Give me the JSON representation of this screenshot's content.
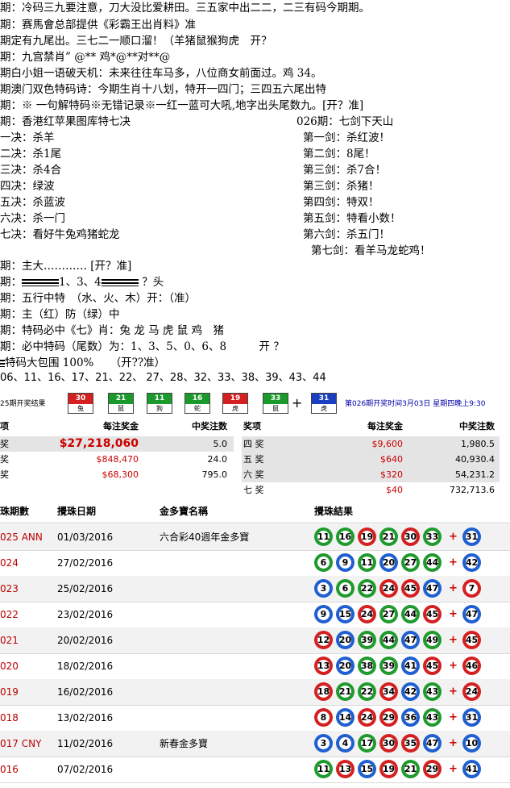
{
  "text_lines": [
    "期：冷码三九要注意，刀大没比爱耕田。三五家中出二二，二三有码今期期。",
    "期：赛馬會总部提供《彩霸王出肖料》准",
    "期定有九尾出。三七二一顺口溜！（羊猪鼠猴狗虎　开？",
    "期：九宫禁肖” @** 鸡*@**对**@",
    "期白小姐一语破天机：未来往往车马多，八位商女前面过。鸡 34。",
    "期澳门双色特码诗：今期生肖十八划，特开一四门；三四五六尾出特",
    "期：※ 一句解特码※无错记录※一红一蓝可大吼,地字出头尾数九。[开？准]"
  ],
  "left_title": "期：香港红苹果图库特七决",
  "left_items": [
    "一决：杀羊",
    "二决：杀1尾",
    "三决：杀4合",
    "四决：绿波",
    "五决：杀蓝波",
    "六决：杀一门",
    "七决：看好牛兔鸡猪蛇龙"
  ],
  "right_title": "026期：七剑下天山",
  "right_items": [
    "第一剑：杀红波！",
    "第二剑：8尾！",
    "第三剑：杀7合！",
    "第三剑：杀猪！",
    "第四剑：特双！",
    "第五剑：特看小数！",
    "第六剑：杀五门！",
    "第七剑：看羊马龙蛇鸡！"
  ],
  "lower_lines": [
    "期：主大………… [开？准]",
    "期：",
    "期：五行中特　（水、火、木）开：（准）",
    "期：主（红）防（绿）中",
    "期：特码必中《七》肖：兔 龙 马 虎 鼠 鸡　猪",
    "期：必中特码（尾数）为：1、3、5、0、6、8　　　开 ？",
    "特码大包围 100%　　（开??准）"
  ],
  "bar_line": {
    "middle": "1、3、4",
    "end": "？头"
  },
  "numbers_line": "06、11、16、17、21、22、 27、28、32、33、38、39、43、44",
  "draw": {
    "label": "25期开奖结果",
    "balls": [
      {
        "num": "30",
        "zodiac": "兔",
        "color": "#d42020"
      },
      {
        "num": "21",
        "zodiac": "鼠",
        "color": "#1a9a2a"
      },
      {
        "num": "11",
        "zodiac": "狗",
        "color": "#1a9a2a"
      },
      {
        "num": "16",
        "zodiac": "蛇",
        "color": "#1a9a2a"
      },
      {
        "num": "19",
        "zodiac": "虎",
        "color": "#d42020"
      },
      {
        "num": "33",
        "zodiac": "鼠",
        "color": "#1a9a2a"
      }
    ],
    "special": {
      "num": "31",
      "zodiac": "虎",
      "color": "#1a3fc0"
    },
    "next_period": "第026期开奖时间3月03日 星期四晚上9:30"
  },
  "prize_left": {
    "headers": [
      "项",
      "每注奖金",
      "中奖注数"
    ],
    "rows": [
      {
        "name": "奖",
        "amount": "$27,218,060",
        "count": "5.0"
      },
      {
        "name": "奖",
        "amount": "$848,470",
        "count": "24.0"
      },
      {
        "name": "奖",
        "amount": "$68,300",
        "count": "795.0"
      }
    ]
  },
  "prize_right": {
    "headers": [
      "奖项",
      "每注奖金",
      "中奖注数"
    ],
    "rows": [
      {
        "name": "四 奖",
        "amount": "$9,600",
        "count": "1,980.5"
      },
      {
        "name": "五 奖",
        "amount": "$640",
        "count": "40,930.4"
      },
      {
        "name": "六 奖",
        "amount": "$320",
        "count": "54,231.2"
      },
      {
        "name": "七 奖",
        "amount": "$40",
        "count": "732,713.6"
      }
    ]
  },
  "history": {
    "headers": [
      "珠期數",
      "攪珠日期",
      "金多寶名稱",
      "攪珠結果"
    ],
    "rows": [
      {
        "id": "025 ANN",
        "date": "01/03/2016",
        "name": "六合彩40週年金多寶",
        "balls": [
          [
            "11",
            "g"
          ],
          [
            "16",
            "g"
          ],
          [
            "19",
            "r"
          ],
          [
            "21",
            "g"
          ],
          [
            "30",
            "r"
          ],
          [
            "33",
            "g"
          ]
        ],
        "special": [
          "31",
          "b"
        ]
      },
      {
        "id": "024",
        "date": "27/02/2016",
        "name": "",
        "balls": [
          [
            "6",
            "g"
          ],
          [
            "9",
            "b"
          ],
          [
            "11",
            "g"
          ],
          [
            "20",
            "b"
          ],
          [
            "27",
            "g"
          ],
          [
            "44",
            "g"
          ]
        ],
        "special": [
          "42",
          "b"
        ]
      },
      {
        "id": "023",
        "date": "25/02/2016",
        "name": "",
        "balls": [
          [
            "3",
            "b"
          ],
          [
            "6",
            "g"
          ],
          [
            "22",
            "g"
          ],
          [
            "24",
            "r"
          ],
          [
            "45",
            "r"
          ],
          [
            "47",
            "b"
          ]
        ],
        "special": [
          "7",
          "r"
        ]
      },
      {
        "id": "022",
        "date": "23/02/2016",
        "name": "",
        "balls": [
          [
            "9",
            "b"
          ],
          [
            "15",
            "b"
          ],
          [
            "24",
            "r"
          ],
          [
            "27",
            "g"
          ],
          [
            "44",
            "g"
          ],
          [
            "45",
            "r"
          ]
        ],
        "special": [
          "47",
          "b"
        ]
      },
      {
        "id": "021",
        "date": "20/02/2016",
        "name": "",
        "balls": [
          [
            "12",
            "r"
          ],
          [
            "20",
            "b"
          ],
          [
            "39",
            "g"
          ],
          [
            "44",
            "g"
          ],
          [
            "47",
            "b"
          ],
          [
            "49",
            "g"
          ]
        ],
        "special": [
          "45",
          "r"
        ]
      },
      {
        "id": "020",
        "date": "18/02/2016",
        "name": "",
        "balls": [
          [
            "13",
            "r"
          ],
          [
            "20",
            "b"
          ],
          [
            "38",
            "g"
          ],
          [
            "39",
            "g"
          ],
          [
            "41",
            "b"
          ],
          [
            "45",
            "r"
          ]
        ],
        "special": [
          "46",
          "r"
        ]
      },
      {
        "id": "019",
        "date": "16/02/2016",
        "name": "",
        "balls": [
          [
            "18",
            "r"
          ],
          [
            "21",
            "g"
          ],
          [
            "22",
            "g"
          ],
          [
            "34",
            "r"
          ],
          [
            "42",
            "b"
          ],
          [
            "43",
            "g"
          ]
        ],
        "special": [
          "24",
          "r"
        ]
      },
      {
        "id": "018",
        "date": "13/02/2016",
        "name": "",
        "balls": [
          [
            "8",
            "r"
          ],
          [
            "14",
            "b"
          ],
          [
            "24",
            "r"
          ],
          [
            "29",
            "r"
          ],
          [
            "36",
            "b"
          ],
          [
            "43",
            "g"
          ]
        ],
        "special": [
          "31",
          "b"
        ]
      },
      {
        "id": "017 CNY",
        "date": "11/02/2016",
        "name": "新春金多寶",
        "balls": [
          [
            "3",
            "b"
          ],
          [
            "4",
            "b"
          ],
          [
            "17",
            "g"
          ],
          [
            "30",
            "r"
          ],
          [
            "35",
            "r"
          ],
          [
            "47",
            "b"
          ]
        ],
        "special": [
          "10",
          "b"
        ]
      },
      {
        "id": "016",
        "date": "07/02/2016",
        "name": "",
        "balls": [
          [
            "11",
            "g"
          ],
          [
            "13",
            "r"
          ],
          [
            "15",
            "b"
          ],
          [
            "19",
            "r"
          ],
          [
            "21",
            "g"
          ],
          [
            "29",
            "r"
          ]
        ],
        "special": [
          "41",
          "b"
        ]
      }
    ]
  },
  "ball_colors": {
    "r": "#d42020",
    "g": "#1f9a2c",
    "b": "#1f5fd0"
  }
}
